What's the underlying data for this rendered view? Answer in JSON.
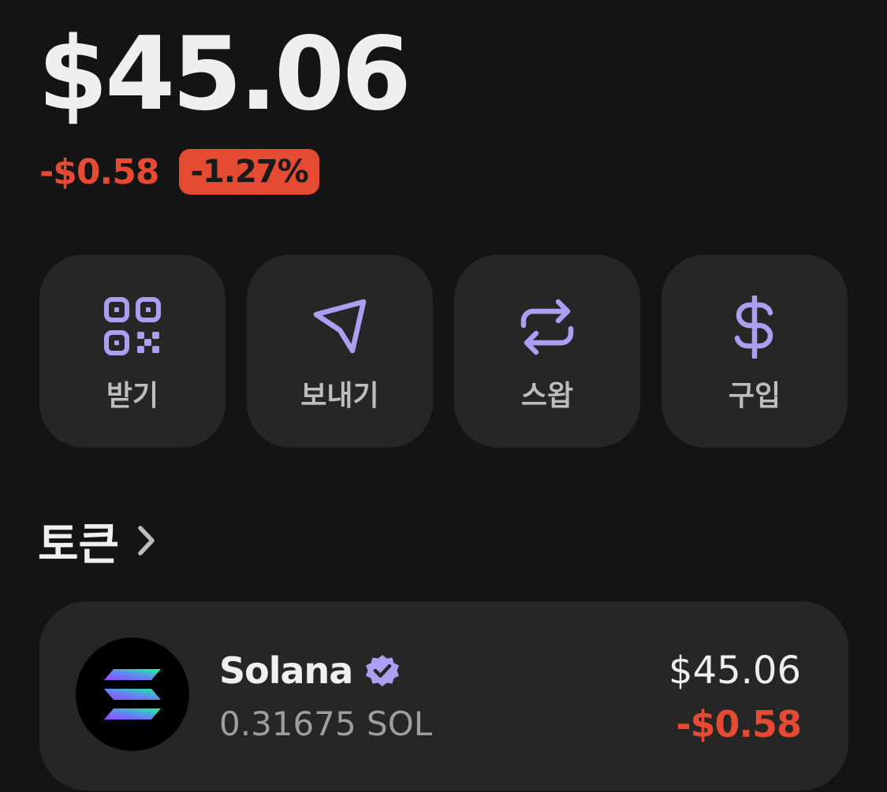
{
  "portfolio": {
    "balance": "$45.06",
    "change_amount": "-$0.58",
    "change_percent": "-1.27%"
  },
  "actions": [
    {
      "label": "받기",
      "icon": "qr-code-icon"
    },
    {
      "label": "보내기",
      "icon": "send-icon"
    },
    {
      "label": "스왑",
      "icon": "swap-icon"
    },
    {
      "label": "구입",
      "icon": "dollar-icon"
    }
  ],
  "tokens_section": {
    "title": "토큰",
    "icon": "chevron-right-icon"
  },
  "tokens": [
    {
      "name": "Solana",
      "amount": "0.31675 SOL",
      "value": "$45.06",
      "change": "-$0.58",
      "verified_icon": "verified-badge-icon"
    }
  ],
  "colors": {
    "background": "#141414",
    "card": "#262626",
    "accent_purple": "#ab9ff2",
    "negative": "#e54b33",
    "text_primary": "#efefef",
    "text_secondary": "#9e9e9e"
  }
}
